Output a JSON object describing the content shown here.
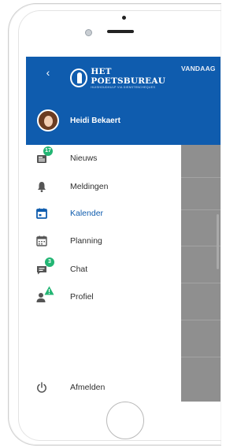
{
  "app": {
    "background_tab": "VANDAAG",
    "brand": {
      "title": "HET POETSBUREAU",
      "subtitle": "HUISHOUDHULP VIA DIENSTENCHEQUES"
    }
  },
  "drawer": {
    "user_name": "Heidi Bekaert",
    "items": [
      {
        "label": "Nieuws",
        "icon": "news-icon",
        "badge": "17"
      },
      {
        "label": "Meldingen",
        "icon": "bell-icon",
        "badge": ""
      },
      {
        "label": "Kalender",
        "icon": "calendar-icon",
        "badge": "",
        "active": true
      },
      {
        "label": "Planning",
        "icon": "planning-icon",
        "badge": ""
      },
      {
        "label": "Chat",
        "icon": "chat-icon",
        "badge": "3"
      },
      {
        "label": "Profiel",
        "icon": "profile-icon",
        "badge": "!"
      }
    ],
    "logout_label": "Afmelden"
  },
  "colors": {
    "brand_blue": "#0f5cae",
    "badge_green": "#22b573",
    "icon_gray": "#555555"
  }
}
